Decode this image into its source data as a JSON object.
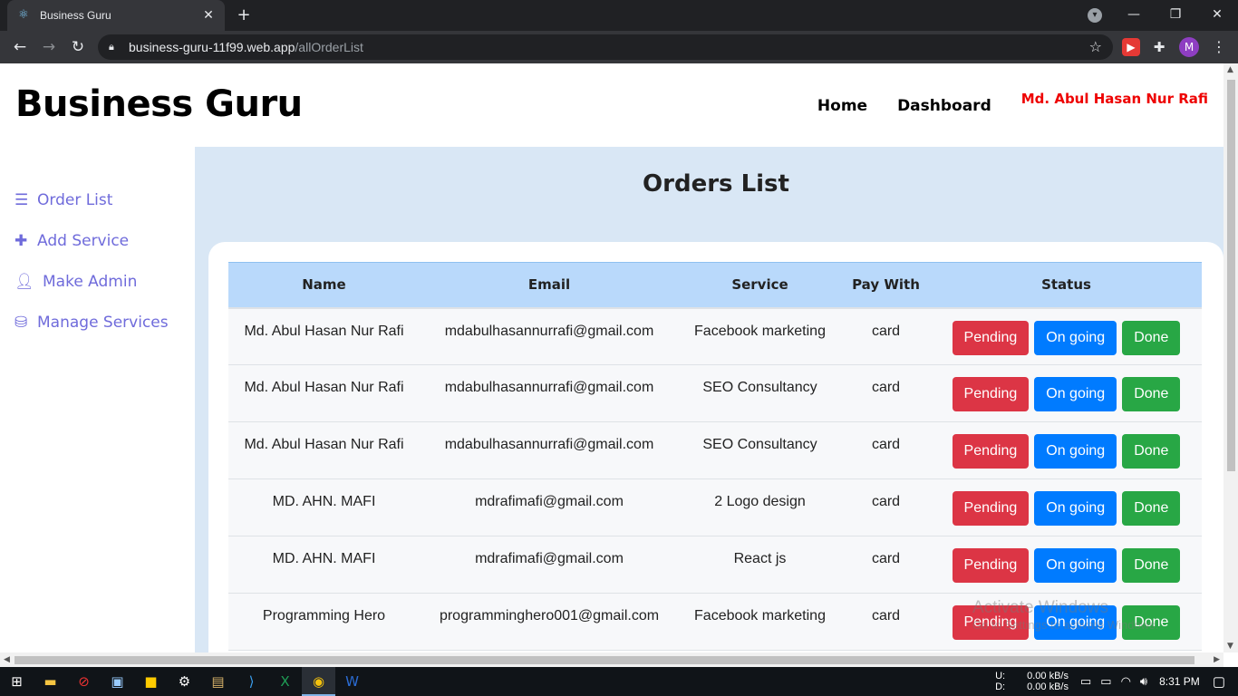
{
  "browser": {
    "tab_title": "Business Guru",
    "url_host": "business-guru-11f99.web.app",
    "url_path": "/allOrderList",
    "profile_initial": "M"
  },
  "header": {
    "brand": "Business Guru",
    "nav": [
      "Home",
      "Dashboard"
    ],
    "user_name": "Md. Abul Hasan Nur Rafi"
  },
  "sidebar": {
    "items": [
      {
        "label": "Order List",
        "icon": "list-icon"
      },
      {
        "label": "Add Service",
        "icon": "plus-icon"
      },
      {
        "label": "Make Admin",
        "icon": "user-shield-icon"
      },
      {
        "label": "Manage Services",
        "icon": "database-icon"
      }
    ]
  },
  "main": {
    "title": "Orders List",
    "columns": [
      "Name",
      "Email",
      "Service",
      "Pay With",
      "Status"
    ],
    "status_buttons": {
      "pending": "Pending",
      "ongoing": "On going",
      "done": "Done"
    },
    "rows": [
      {
        "name": "Md. Abul Hasan Nur Rafi",
        "email": "mdabulhasannurrafi@gmail.com",
        "service": "Facebook marketing",
        "pay": "card"
      },
      {
        "name": "Md. Abul Hasan Nur Rafi",
        "email": "mdabulhasannurrafi@gmail.com",
        "service": "SEO Consultancy",
        "pay": "card"
      },
      {
        "name": "Md. Abul Hasan Nur Rafi",
        "email": "mdabulhasannurrafi@gmail.com",
        "service": "SEO Consultancy",
        "pay": "card"
      },
      {
        "name": "MD. AHN. MAFI",
        "email": "mdrafimafi@gmail.com",
        "service": "2 Logo design",
        "pay": "card"
      },
      {
        "name": "MD. AHN. MAFI",
        "email": "mdrafimafi@gmail.com",
        "service": "React js",
        "pay": "card"
      },
      {
        "name": "Programming Hero",
        "email": "programminghero001@gmail.com",
        "service": "Facebook marketing",
        "pay": "card"
      }
    ]
  },
  "watermark": {
    "line1": "Activate Windows",
    "line2": "Go to Settings to activate Windows."
  },
  "taskbar": {
    "net_upload_label": "U:",
    "net_download_label": "D:",
    "net_upload": "0.00 kB/s",
    "net_download": "0.00 kB/s",
    "time": "8:31 PM"
  }
}
